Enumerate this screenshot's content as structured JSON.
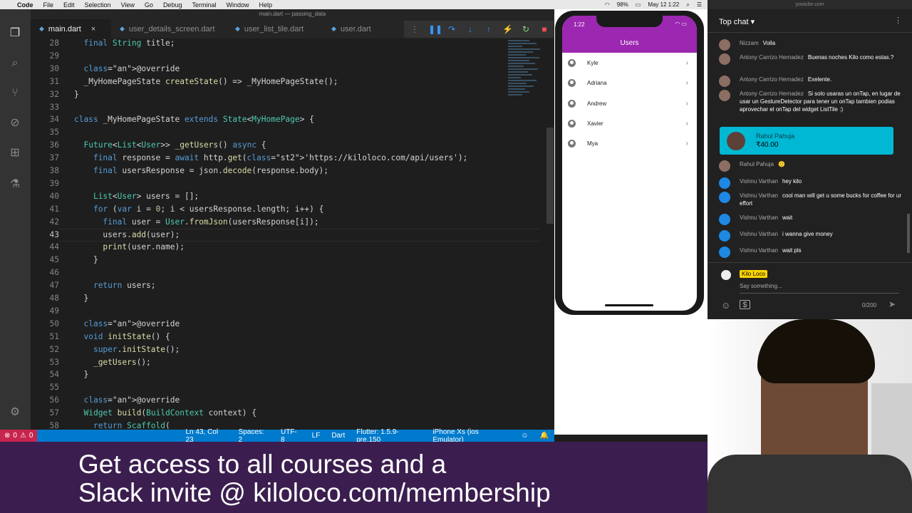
{
  "menubar": {
    "app": "Code",
    "items": [
      "File",
      "Edit",
      "Selection",
      "View",
      "Go",
      "Debug",
      "Terminal",
      "Window",
      "Help"
    ],
    "battery": "98%",
    "datetime": "May 12  1:22"
  },
  "editor": {
    "window_title": "main.dart — passing_data",
    "tabs": [
      {
        "label": "main.dart",
        "active": true
      },
      {
        "label": "user_details_screen.dart",
        "active": false
      },
      {
        "label": "user_list_tile.dart",
        "active": false
      },
      {
        "label": "user.dart",
        "active": false
      }
    ],
    "lines": [
      {
        "n": "28",
        "text": "  final String title;"
      },
      {
        "n": "29",
        "text": ""
      },
      {
        "n": "30",
        "text": "  @override"
      },
      {
        "n": "31",
        "text": "  _MyHomePageState createState() => _MyHomePageState();"
      },
      {
        "n": "32",
        "text": "}"
      },
      {
        "n": "33",
        "text": ""
      },
      {
        "n": "34",
        "text": "class _MyHomePageState extends State<MyHomePage> {"
      },
      {
        "n": "35",
        "text": ""
      },
      {
        "n": "36",
        "text": "  Future<List<User>> _getUsers() async {"
      },
      {
        "n": "37",
        "text": "    final response = await http.get('https://kiloloco.com/api/users');"
      },
      {
        "n": "38",
        "text": "    final usersResponse = json.decode(response.body);"
      },
      {
        "n": "39",
        "text": ""
      },
      {
        "n": "40",
        "text": "    List<User> users = [];"
      },
      {
        "n": "41",
        "text": "    for (var i = 0; i < usersResponse.length; i++) {"
      },
      {
        "n": "42",
        "text": "      final user = User.fromJson(usersResponse[i]);"
      },
      {
        "n": "43",
        "text": "      users.add(user);"
      },
      {
        "n": "44",
        "text": "      print(user.name);"
      },
      {
        "n": "45",
        "text": "    }"
      },
      {
        "n": "46",
        "text": ""
      },
      {
        "n": "47",
        "text": "    return users;"
      },
      {
        "n": "48",
        "text": "  }"
      },
      {
        "n": "49",
        "text": ""
      },
      {
        "n": "50",
        "text": "  @override"
      },
      {
        "n": "51",
        "text": "  void initState() {"
      },
      {
        "n": "52",
        "text": "    super.initState();"
      },
      {
        "n": "53",
        "text": "    _getUsers();"
      },
      {
        "n": "54",
        "text": "  }"
      },
      {
        "n": "55",
        "text": ""
      },
      {
        "n": "56",
        "text": "  @override"
      },
      {
        "n": "57",
        "text": "  Widget build(BuildContext context) {"
      },
      {
        "n": "58",
        "text": "    return Scaffold("
      }
    ],
    "current_line": "43"
  },
  "statusbar": {
    "errors": "0",
    "warnings": "0",
    "position": "Ln 43, Col 23",
    "spaces": "Spaces: 2",
    "encoding": "UTF-8",
    "eol": "LF",
    "language": "Dart",
    "flutter": "Flutter: 1.5.9-pre.150",
    "device": "iPhone Xs (ios Emulator)"
  },
  "simulator": {
    "time": "1:22",
    "title": "Users",
    "users": [
      "Kyle",
      "Adriana",
      "Andrew",
      "Xavier",
      "Mya"
    ],
    "accent": "#9c27b0"
  },
  "banner": {
    "line1": "Get access to all courses and a",
    "line2": "Slack invite @ kiloloco.com/membership"
  },
  "chat": {
    "url": "youtube.com",
    "header": "Top chat",
    "messages": [
      {
        "author": "Nizzam",
        "text": "Voila"
      },
      {
        "author": "Antony Carrizo Hernadez",
        "text": "Buenas noches Kilo como estas.?"
      },
      {
        "author": "Antony Carrizo Hernadez",
        "text": "Exelente."
      },
      {
        "author": "Antony Carrizo Hernadez",
        "text": "Si solo usaras un onTap, en lugar de usar un GestureDetector para tener un onTap tambien podias aprovechar el onTap del widget ListTile :)"
      },
      {
        "author": "Rahul Pahuja",
        "text": "🙂"
      },
      {
        "author": "Vishnu Varthan",
        "text": "hey kilo"
      },
      {
        "author": "Vishnu Varthan",
        "text": "cool man will get u some bucks for coffee for ur effort"
      },
      {
        "author": "Vishnu Varthan",
        "text": "wait"
      },
      {
        "author": "Vishnu Varthan",
        "text": "i wanna give money"
      },
      {
        "author": "Vishnu Varthan",
        "text": "wait pls"
      }
    ],
    "superchat": {
      "name": "Rahul Pahuja",
      "amount": "₹40.00",
      "color": "#00b8d4"
    },
    "input": {
      "badge": "Kilo Loco",
      "placeholder": "Say something...",
      "counter": "0/200"
    }
  }
}
